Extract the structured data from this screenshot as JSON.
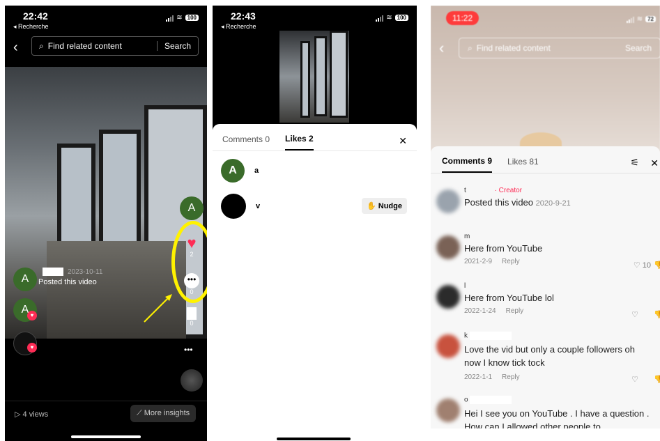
{
  "panel1": {
    "time": "22:42",
    "back_app": "◂ Recherche",
    "battery": "100",
    "search_placeholder": "Find related content",
    "search_button": "Search",
    "poster_avatar": "A",
    "poster_date": "2023-10-11",
    "poster_caption": "Posted this video",
    "side_avatar": "A",
    "like_count": "2",
    "comment_count": "0",
    "save_count": "0",
    "liker_avatar": "A",
    "views": "4 views",
    "insights": "More insights",
    "more": "•••"
  },
  "panel2": {
    "time": "22:43",
    "back_app": "◂ Recherche",
    "battery": "100",
    "tab_comments": "Comments 0",
    "tab_likes": "Likes 2",
    "close": "✕",
    "users": [
      {
        "avatar": "A",
        "name": "a"
      },
      {
        "avatar": "",
        "name": "v"
      }
    ],
    "nudge": "Nudge"
  },
  "panel3": {
    "time": "11:22",
    "battery": "72",
    "search_placeholder": "Find related content",
    "search_button": "Search",
    "tab_comments": "Comments 9",
    "tab_likes": "Likes 81",
    "close": "✕",
    "comments": [
      {
        "user": "t",
        "badge": "· Creator",
        "text": "Posted this video",
        "date": "2020-9-21",
        "reply": "",
        "likes": ""
      },
      {
        "user": "m",
        "badge": "",
        "text": "Here from YouTube",
        "date": "2021-2-9",
        "reply": "Reply",
        "likes": "10"
      },
      {
        "user": "l",
        "badge": "",
        "text": "Here from YouTube lol",
        "date": "2022-1-24",
        "reply": "Reply",
        "likes": ""
      },
      {
        "user": "k",
        "badge": "",
        "text": "Love the vid but only a couple followers oh now I know tick tock",
        "date": "2022-1-1",
        "reply": "Reply",
        "likes": ""
      },
      {
        "user": "o",
        "badge": "",
        "text": "Hei I see you on YouTube . I have a question . How can I allowed other people to",
        "date": "",
        "reply": "",
        "likes": ""
      }
    ]
  },
  "colors": {
    "like_red": "#fe2c55",
    "highlight_yellow": "#fff200",
    "avatar_green": "#3a6b2a",
    "creator_pink": "#fe2c55"
  }
}
